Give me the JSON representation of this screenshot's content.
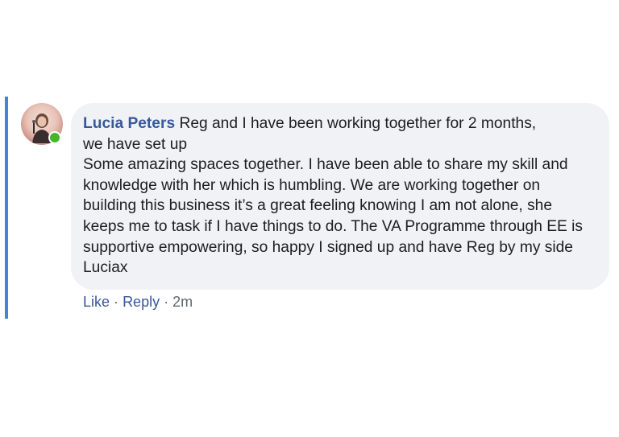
{
  "comment": {
    "author": "Lucia Peters",
    "text": "Reg and I have been working together for 2 months,\nwe have set up\nSome amazing spaces together. I have been able to share my skill and knowledge with her which is humbling. We are working together on building this business it’s a great feeling knowing I am not alone, she keeps me to task if I have things to do. The VA Programme through EE is supportive empowering, so happy I signed up and have Reg by my side Luciax",
    "online": true
  },
  "actions": {
    "like_label": "Like",
    "separator": "·",
    "reply_label": "Reply",
    "timestamp": "2m"
  },
  "colors": {
    "thread_accent": "#4a7fe0",
    "author_link": "#385898",
    "bubble_bg": "#f0f2f5",
    "online_status": "#42b72a"
  }
}
